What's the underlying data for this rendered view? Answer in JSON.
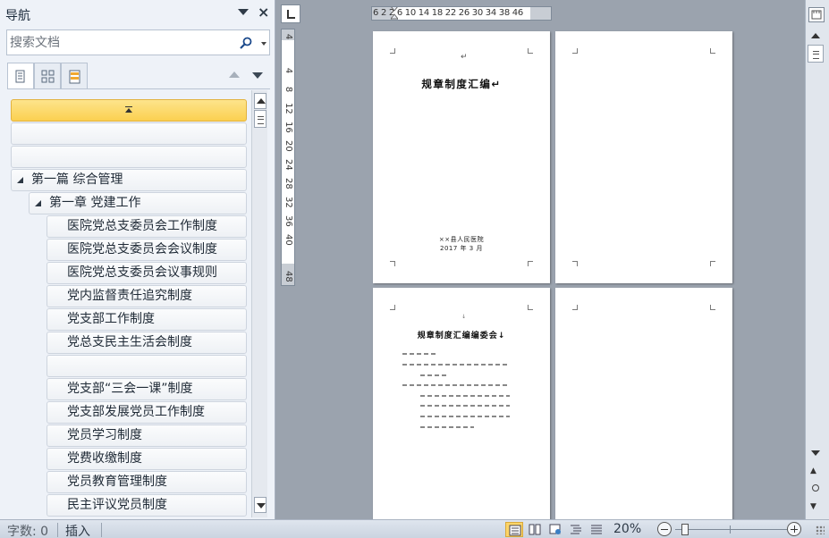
{
  "nav": {
    "title": "导航",
    "search_placeholder": "搜索文档",
    "items": [
      {
        "label": "",
        "level": 0,
        "selected": true
      },
      {
        "label": "",
        "level": 0
      },
      {
        "label": "",
        "level": 0
      },
      {
        "label": "第一篇 综合管理",
        "level": 1,
        "expanded": true
      },
      {
        "label": "第一章 党建工作",
        "level": 2,
        "expanded": true
      },
      {
        "label": "医院党总支委员会工作制度",
        "level": 3
      },
      {
        "label": "医院党总支委员会会议制度",
        "level": 3
      },
      {
        "label": "医院党总支委员会议事规则",
        "level": 3
      },
      {
        "label": "党内监督责任追究制度",
        "level": 3
      },
      {
        "label": "党支部工作制度",
        "level": 3
      },
      {
        "label": "党总支民主生活会制度",
        "level": 3
      },
      {
        "label": "",
        "level": 3
      },
      {
        "label": "党支部“三会一课”制度",
        "level": 3
      },
      {
        "label": "党支部发展党员工作制度",
        "level": 3
      },
      {
        "label": "党员学习制度",
        "level": 3
      },
      {
        "label": "党费收缴制度",
        "level": 3
      },
      {
        "label": "党员教育管理制度",
        "level": 3
      },
      {
        "label": "民主评议党员制度",
        "level": 3
      }
    ]
  },
  "ruler": {
    "horizontal": "6 2 2 6 10 14 18 22 26 30 34 38 46",
    "vertical": [
      "4",
      "4",
      "8",
      "12",
      "16",
      "20",
      "24",
      "28",
      "32",
      "36",
      "40",
      "48"
    ]
  },
  "document": {
    "page1": {
      "mark": "↵",
      "title": "规章制度汇编↵",
      "org": "××县人民医院",
      "date": "2017 年 3 月"
    },
    "page3": {
      "mark": "↓",
      "title": "规章制度汇编编委会↓"
    }
  },
  "status": {
    "word_count": "字数: 0",
    "mode": "插入",
    "zoom": "20%"
  }
}
